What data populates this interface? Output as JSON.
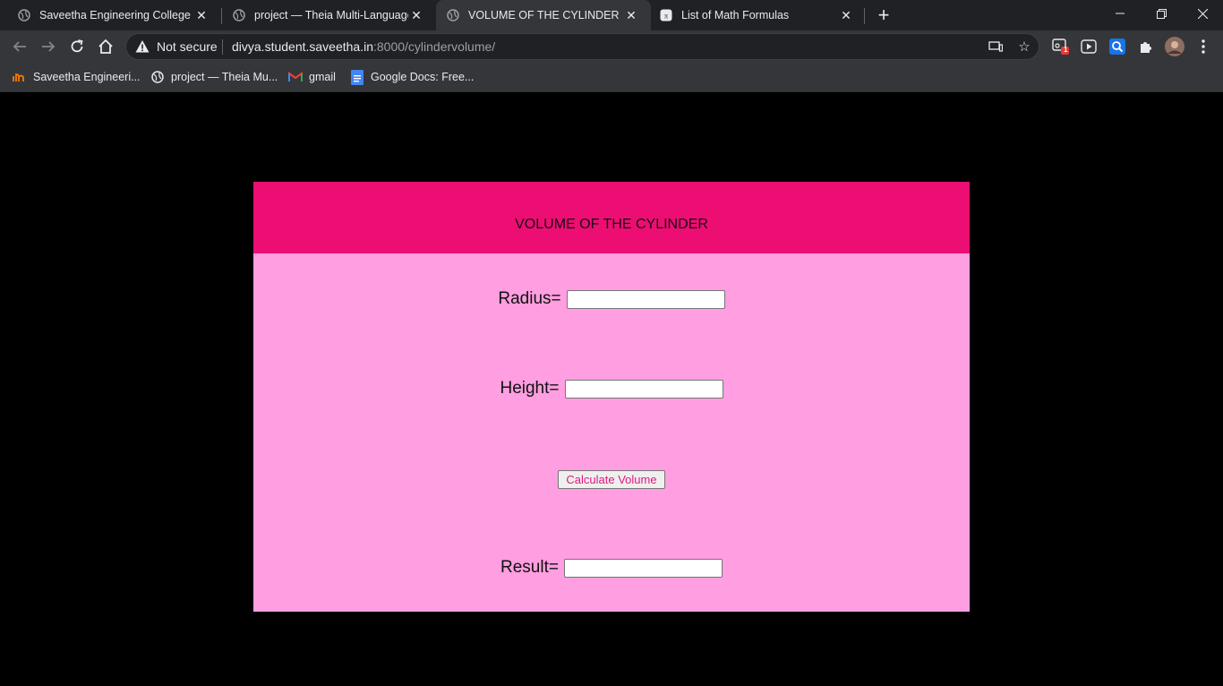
{
  "browser": {
    "tabs": [
      {
        "title": "Saveetha Engineering College",
        "active": false
      },
      {
        "title": "project — Theia Multi-Language",
        "active": false
      },
      {
        "title": "VOLUME OF THE CYLINDER",
        "active": true
      },
      {
        "title": "List of Math Formulas",
        "active": false
      }
    ],
    "address": {
      "security_label": "Not secure",
      "url_host": "divya.student.saveetha.in",
      "url_rest": ":8000/cylindervolume/"
    },
    "extension_badge": "1",
    "bookmarks": [
      {
        "label": "Saveetha Engineeri..."
      },
      {
        "label": "project — Theia Mu..."
      },
      {
        "label": "gmail"
      },
      {
        "label": "Google Docs: Free..."
      }
    ]
  },
  "page": {
    "heading": "VOLUME OF THE CYLINDER",
    "radius_label": "Radius=",
    "radius_value": "",
    "height_label": "Height=",
    "height_value": "",
    "button_label": "Calculate Volume",
    "result_label": "Result=",
    "result_value": "",
    "colors": {
      "header": "#ec0e73",
      "body": "#ff9ee0",
      "background": "#000000"
    }
  }
}
